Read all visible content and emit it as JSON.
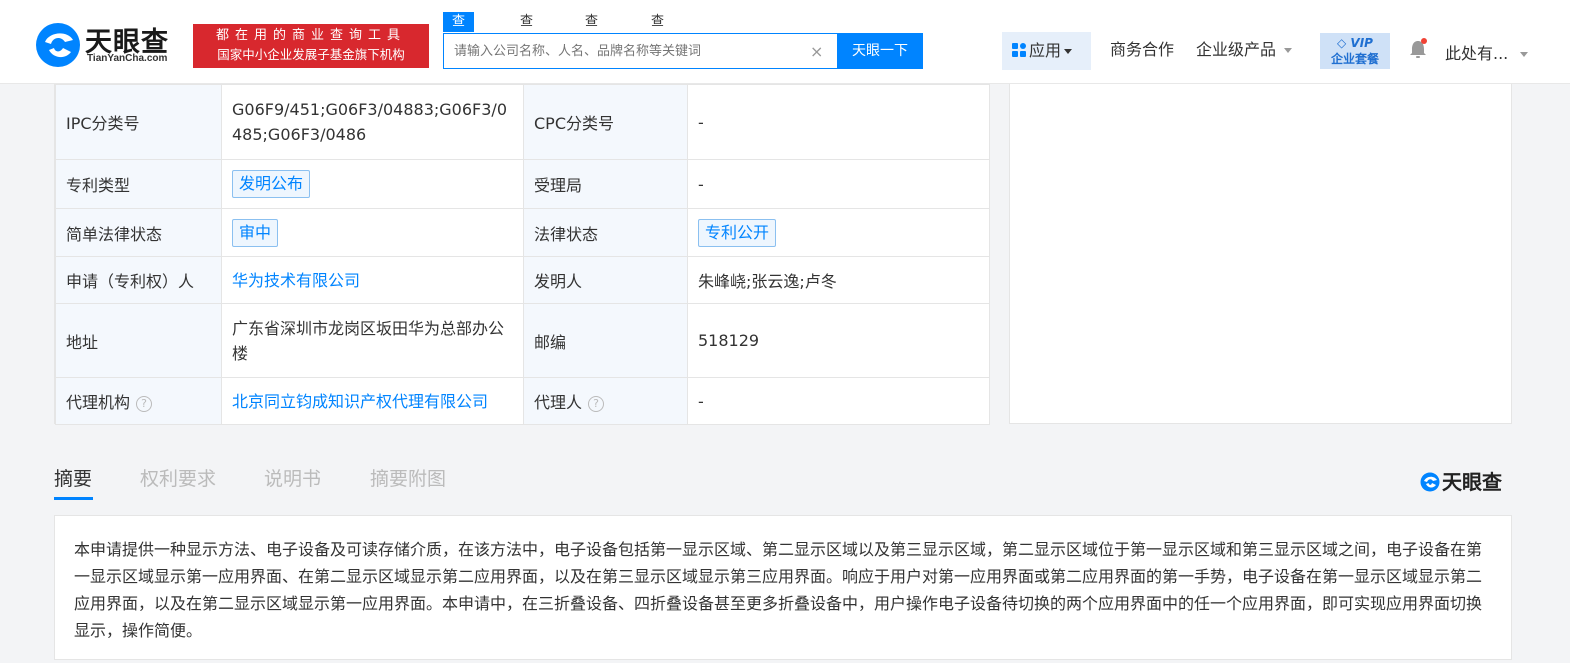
{
  "header": {
    "logo_text": "天眼查",
    "logo_sub": "TianYanCha.com",
    "banner_line1": "都在用的商业查询工具",
    "banner_line2": "国家中小企业发展子基金旗下机构",
    "search_tabs": [
      "查公司",
      "查老板",
      "查关系",
      "查风险"
    ],
    "search_placeholder": "请输入公司名称、人名、品牌名称等关键词",
    "search_clear": "×",
    "search_button": "天眼一下",
    "nav_app": "应用",
    "nav_business": "商务合作",
    "nav_enterprise": "企业级产品",
    "vip_line1": "VIP",
    "vip_line2": "企业套餐",
    "user_name": "此处有..."
  },
  "patent_info": {
    "ipc_label": "IPC分类号",
    "ipc_value": "G06F9/451;G06F3/04883;G06F3/0485;G06F3/0486",
    "cpc_label": "CPC分类号",
    "cpc_value": "-",
    "type_label": "专利类型",
    "type_value": "发明公布",
    "office_label": "受理局",
    "office_value": "-",
    "simple_status_label": "简单法律状态",
    "simple_status_value": "审中",
    "legal_status_label": "法律状态",
    "legal_status_value": "专利公开",
    "applicant_label": "申请（专利权）人",
    "applicant_value": "华为技术有限公司",
    "inventor_label": "发明人",
    "inventor_value": "朱峰峣;张云逸;卢冬",
    "address_label": "地址",
    "address_value": "广东省深圳市龙岗区坂田华为总部办公楼",
    "zip_label": "邮编",
    "zip_value": "518129",
    "agency_label": "代理机构",
    "agency_value": "北京同立钧成知识产权代理有限公司",
    "agent_label": "代理人",
    "agent_value": "-",
    "help_glyph": "?"
  },
  "tabs": {
    "items": [
      "摘要",
      "权利要求",
      "说明书",
      "摘要附图"
    ],
    "brand": "天眼查"
  },
  "abstract_text": "本申请提供一种显示方法、电子设备及可读存储介质，在该方法中，电子设备包括第一显示区域、第二显示区域以及第三显示区域，第二显示区域位于第一显示区域和第三显示区域之间，电子设备在第一显示区域显示第一应用界面、在第二显示区域显示第二应用界面，以及在第三显示区域显示第三应用界面。响应于用户对第一应用界面或第二应用界面的第一手势，电子设备在第一显示区域显示第二应用界面，以及在第二显示区域显示第一应用界面。本申请中，在三折叠设备、四折叠设备甚至更多折叠设备中，用户操作电子设备待切换的两个应用界面中的任一个应用界面，即可实现应用界面切换显示，操作简便。",
  "colors": {
    "accent": "#0084ff",
    "banner_red": "#d8282e",
    "label_bg": "#f4f8fd"
  }
}
